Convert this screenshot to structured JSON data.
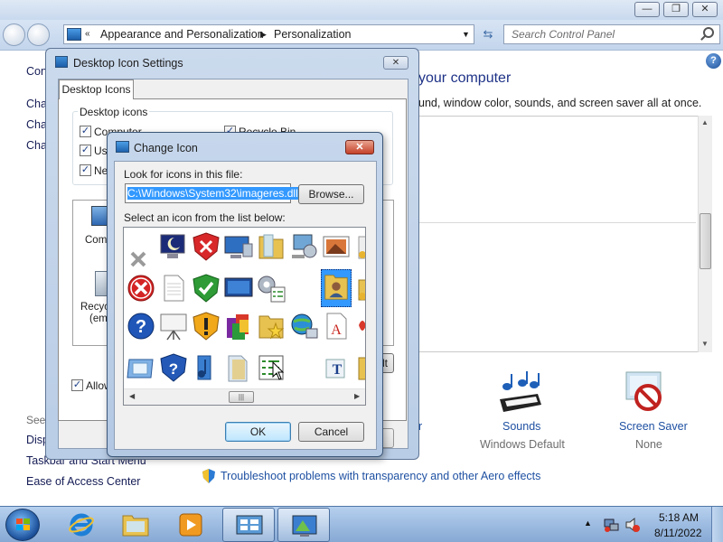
{
  "control_panel": {
    "breadcrumb": [
      "Appearance and Personalization",
      "Personalization"
    ],
    "search_placeholder": "Search Control Panel",
    "left_links": [
      "Con",
      "Cha",
      "Cha",
      "Cha"
    ],
    "see_also": "See",
    "see_also_links": [
      "Disp",
      "Taskbar and Start Menu",
      "Ease of Access Center"
    ],
    "heading": "your computer",
    "subtitle": "und, window color, sounds, and screen saver all at once.",
    "color_label": "or",
    "sounds_label": "Sounds",
    "sounds_value": "Windows Default",
    "screensaver_label": "Screen Saver",
    "screensaver_value": "None",
    "troubleshoot": "Troubleshoot problems with transparency and other Aero effects"
  },
  "desktop_icon_settings": {
    "title": "Desktop Icon Settings",
    "tab": "Desktop Icons",
    "group_label": "Desktop icons",
    "checkboxes": [
      {
        "label": "Computer",
        "checked": true
      },
      {
        "label": "Use",
        "checked": true
      },
      {
        "label": "Ne",
        "checked": true
      },
      {
        "label": "Recycle Bin",
        "checked": true
      }
    ],
    "icons": [
      "Comp",
      "Recyc",
      "(emp"
    ],
    "allow_label": "Allow",
    "button_fragment": "lt"
  },
  "change_icon": {
    "title": "Change Icon",
    "look_label": "Look for icons in this file:",
    "file_path": "C:\\Windows\\System32\\imageres.dll",
    "browse": "Browse...",
    "select_label": "Select an icon from the list below:",
    "ok": "OK",
    "cancel": "Cancel"
  },
  "taskbar": {
    "time": "5:18 AM",
    "date": "8/11/2022"
  }
}
